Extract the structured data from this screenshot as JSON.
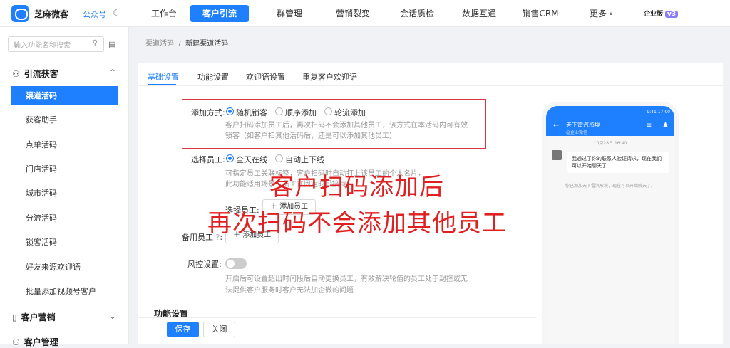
{
  "brand": "芝麻微客",
  "public_account": "公众号",
  "nav": [
    "工作台",
    "客户引流",
    "群管理",
    "营销裂变",
    "会话质检",
    "数据互通",
    "销售CRM",
    "更多"
  ],
  "more_chevron": "∨",
  "edition": "企业版",
  "edition_badge": "v3",
  "search_placeholder": "输入功能名称搜索",
  "sidebar_groups": [
    "引流获客",
    "客户营销",
    "客户管理"
  ],
  "sidebar_items": [
    "渠道活码",
    "获客助手",
    "点单活码",
    "门店活码",
    "城市活码",
    "分流活码",
    "锁客活码",
    "好友来源欢迎语",
    "批量添加视频号客户"
  ],
  "breadcrumb": {
    "parent": "渠道活码",
    "sep": "/",
    "current": "新建渠道活码"
  },
  "tabs": [
    "基础设置",
    "功能设置",
    "欢迎语设置",
    "重复客户欢迎语"
  ],
  "form": {
    "add_mode_label": "添加方式:",
    "add_mode_options": [
      "随机锁客",
      "顺序添加",
      "轮流添加"
    ],
    "add_mode_hint1": "客户扫码添加员工后，再次扫码不会添加其他员工，该方式在本活码内可有效",
    "add_mode_hint2": "锁客（如客户扫其他活码后，还是可以添加其他员工）",
    "select_staff_label": "选择员工:",
    "select_staff_options": [
      "全天在线",
      "自动上下线"
    ],
    "select_staff_hint1": "可指定员工关联标签，客户扫码时自动打上该员工的个人名片，",
    "select_staff_hint2": "此功能适用场景：员工在固定时段接待",
    "select_staff_inner_label": "选择员工:",
    "add_staff_btn": "添加员工",
    "backup_staff_label": "备用员工",
    "add_staff_btn2": "添加员工",
    "risk_label": "风控设置:",
    "risk_hint1": "开启后可设置超出时间段后自动更换员工，有效解决轮值的员工处于封控或无",
    "risk_hint2": "法提供客户服务时客户无法加企微的问题",
    "section_title": "功能设置"
  },
  "buttons": {
    "save": "保存",
    "close": "关闭"
  },
  "phone": {
    "status": "9:41 17:00",
    "title": "天下雷汽彤境",
    "subtitle": "@企业微信",
    "time": "10月28日 16:40",
    "bubble": "我通过了你的联系人验证请求，现在我们可以开始聊天了",
    "notice": "你已添加天下雷汽彤境，现在可以开始聊天了。"
  },
  "overlay": {
    "line1": "客户扫码添加后",
    "line2": "再次扫码不会添加其他员工"
  },
  "colors": {
    "primary": "#1e80ff",
    "annotation": "#e02020"
  }
}
